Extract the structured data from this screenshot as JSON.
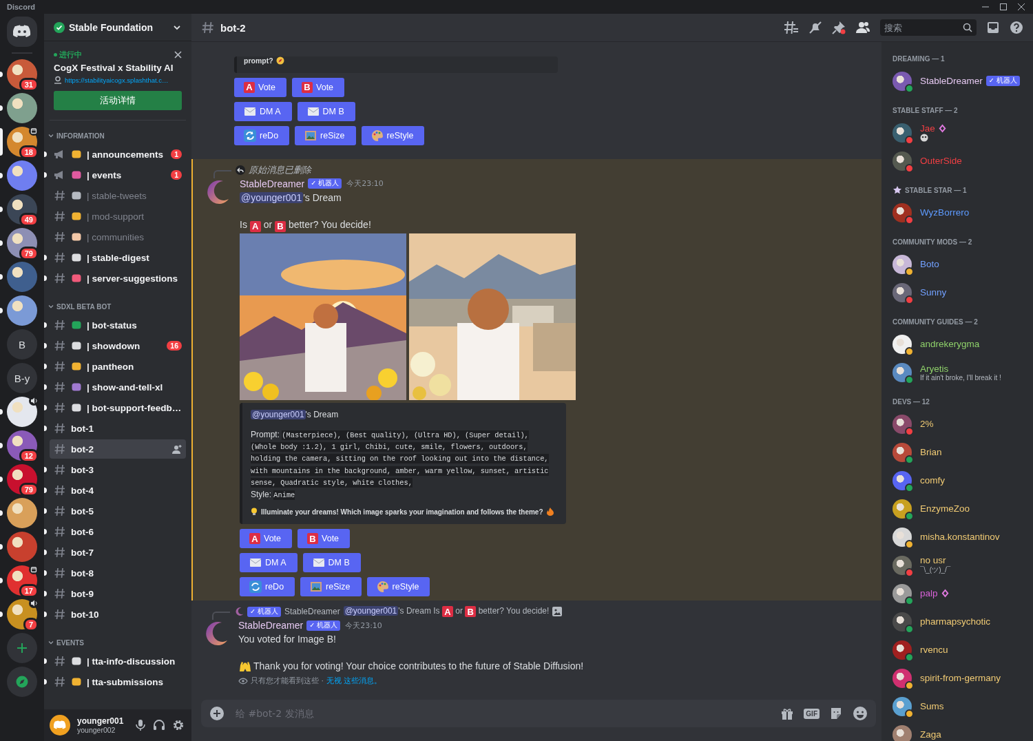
{
  "window": {
    "title": "Discord"
  },
  "servers": [
    {
      "badge": "31",
      "unread": true,
      "selected": false
    },
    {
      "unread": true,
      "selected": false
    },
    {
      "badge": "18",
      "unread": false,
      "selected": true,
      "event": true
    },
    {
      "unread": true,
      "selected": false
    },
    {
      "badge": "49",
      "unread": true,
      "selected": false
    },
    {
      "badge": "79",
      "unread": true,
      "selected": false
    },
    {
      "unread": true,
      "selected": false
    },
    {
      "unread": true,
      "selected": false
    },
    {
      "label": "B",
      "unread": false,
      "selected": false
    },
    {
      "label": "B-y",
      "unread": false,
      "selected": false
    },
    {
      "unread": true,
      "selected": false,
      "voice": true
    },
    {
      "badge": "12",
      "unread": true,
      "selected": false
    },
    {
      "badge": "79",
      "unread": true,
      "selected": false
    },
    {
      "unread": true,
      "selected": false
    },
    {
      "unread": true,
      "selected": false
    },
    {
      "badge": "17",
      "unread": true,
      "selected": false,
      "event": true
    },
    {
      "badge": "7",
      "unread": true,
      "selected": false,
      "voice": true
    }
  ],
  "server": {
    "name": "Stable Foundation"
  },
  "event": {
    "status": "进行中",
    "title": "CogX Festival x Stability AI",
    "link": "https://stabilityaicogx.splashthat.c…",
    "button": "活动详情"
  },
  "categories": [
    {
      "name": "INFORMATION",
      "expanded": true,
      "channels": [
        {
          "kind": "announce",
          "emoji": true,
          "name": "| announcements",
          "unread": true,
          "selected": false,
          "badge": "1"
        },
        {
          "kind": "announce",
          "emoji": true,
          "name": "| events",
          "unread": true,
          "selected": false,
          "badge": "1"
        },
        {
          "kind": "text",
          "emoji": true,
          "name": "| stable-tweets",
          "unread": false,
          "selected": false
        },
        {
          "kind": "text",
          "emoji": true,
          "name": "| mod-support",
          "unread": false,
          "selected": false
        },
        {
          "kind": "text",
          "emoji": true,
          "name": "| communities",
          "unread": false,
          "selected": false
        },
        {
          "kind": "text",
          "emoji": true,
          "name": "| stable-digest",
          "unread": true,
          "selected": false
        },
        {
          "kind": "text",
          "emoji": true,
          "name": "| server-suggestions",
          "unread": true,
          "selected": false
        }
      ]
    },
    {
      "name": "SDXL BETA BOT",
      "expanded": true,
      "channels": [
        {
          "kind": "text",
          "emoji": true,
          "name": "| bot-status",
          "unread": true,
          "selected": false
        },
        {
          "kind": "text",
          "emoji": true,
          "name": "| showdown",
          "unread": true,
          "selected": false,
          "badge": "16"
        },
        {
          "kind": "text",
          "emoji": true,
          "name": "| pantheon",
          "unread": true,
          "selected": false
        },
        {
          "kind": "text",
          "emoji": true,
          "name": "| show-and-tell-xl",
          "unread": true,
          "selected": false
        },
        {
          "kind": "text",
          "emoji": true,
          "name": "| bot-support-feedb…",
          "unread": true,
          "selected": false
        },
        {
          "kind": "text",
          "emoji": false,
          "name": "bot-1",
          "unread": true,
          "selected": false
        },
        {
          "kind": "text",
          "emoji": false,
          "name": "bot-2",
          "unread": false,
          "selected": true
        },
        {
          "kind": "text",
          "emoji": false,
          "name": "bot-3",
          "unread": true,
          "selected": false
        },
        {
          "kind": "text",
          "emoji": false,
          "name": "bot-4",
          "unread": true,
          "selected": false
        },
        {
          "kind": "text",
          "emoji": false,
          "name": "bot-5",
          "unread": true,
          "selected": false
        },
        {
          "kind": "text",
          "emoji": false,
          "name": "bot-6",
          "unread": true,
          "selected": false
        },
        {
          "kind": "text",
          "emoji": false,
          "name": "bot-7",
          "unread": true,
          "selected": false
        },
        {
          "kind": "text",
          "emoji": false,
          "name": "bot-8",
          "unread": true,
          "selected": false
        },
        {
          "kind": "text",
          "emoji": false,
          "name": "bot-9",
          "unread": true,
          "selected": false
        },
        {
          "kind": "text",
          "emoji": false,
          "name": "bot-10",
          "unread": true,
          "selected": false
        }
      ]
    },
    {
      "name": "EVENTS",
      "expanded": true,
      "channels": [
        {
          "kind": "text",
          "emoji": true,
          "name": "| tta-info-discussion",
          "unread": true,
          "selected": false
        },
        {
          "kind": "text",
          "emoji": true,
          "name": "| tta-submissions",
          "unread": true,
          "selected": false
        }
      ]
    }
  ],
  "user": {
    "name": "younger001",
    "tag": "younger002"
  },
  "header": {
    "channel": "bot-2",
    "search_placeholder": "搜索"
  },
  "top_embed": {
    "text": "prompt?"
  },
  "top_buttons": [
    [
      {
        "kind": "letter",
        "letter": "A",
        "label": "Vote"
      },
      {
        "kind": "letter",
        "letter": "B",
        "label": "Vote"
      }
    ],
    [
      {
        "kind": "mail",
        "label": "DM A"
      },
      {
        "kind": "mail",
        "label": "DM B"
      }
    ],
    [
      {
        "kind": "redo",
        "label": "reDo"
      },
      {
        "kind": "resize",
        "label": "reSize"
      },
      {
        "kind": "palette",
        "label": "reStyle"
      }
    ]
  ],
  "dream_message": {
    "highlighted": true,
    "reply": "原始消息已删除",
    "author": "StableDreamer",
    "bot_tag": "✓ 机器人",
    "time": "今天23:10",
    "mention": "@younger001",
    "mention_suffix": "'s Dream",
    "choice": [
      {
        "kind": "text",
        "text": "Is"
      },
      {
        "kind": "letter",
        "text": "A"
      },
      {
        "kind": "text",
        "text": "or"
      },
      {
        "kind": "letter",
        "text": "B"
      },
      {
        "kind": "text",
        "text": "better? You decide!"
      }
    ],
    "images": [
      {
        "kind": "picture"
      },
      {
        "kind": "picture"
      }
    ],
    "embed": {
      "mention": "@younger001",
      "mention_suffix": "'s Dream",
      "prompt_label": "Prompt:",
      "prompt": "(Masterpiece), (Best quality), (Ultra HD), (Super detail), (Whole body :1.2), 1 girl, Chibi, cute, smile, flowers, outdoors, holding the camera, sitting on the roof looking out into the distance, with mountains in the background, amber, warm yellow, sunset, artistic sense, Quadratic style, white clothes,",
      "style_label": "Style:",
      "style": "Anime",
      "footer": "Illuminate your dreams! Which image sparks your imagination and follows the theme?"
    },
    "buttons": [
      [
        {
          "kind": "letter",
          "letter": "A",
          "label": "Vote"
        },
        {
          "kind": "letter",
          "letter": "B",
          "label": "Vote"
        }
      ],
      [
        {
          "kind": "mail",
          "label": "DM A"
        },
        {
          "kind": "mail",
          "label": "DM B"
        }
      ],
      [
        {
          "kind": "redo",
          "label": "reDo"
        },
        {
          "kind": "resize",
          "label": "reSize"
        },
        {
          "kind": "palette",
          "label": "reStyle"
        }
      ]
    ]
  },
  "vote_message": {
    "reply": {
      "bot_tag": "✓ 机器人",
      "author": "StableDreamer",
      "mention": "@younger001",
      "segments": [
        {
          "kind": "text",
          "text": "'s Dream Is"
        },
        {
          "kind": "letter",
          "text": "A"
        },
        {
          "kind": "text",
          "text": "or"
        },
        {
          "kind": "letter",
          "text": "B"
        },
        {
          "kind": "text",
          "text": "better? You decide!"
        }
      ]
    },
    "author": "StableDreamer",
    "bot_tag": "✓ 机器人",
    "time": "今天23:10",
    "lines": [
      "You voted for Image B!",
      "Thank you for voting! Your choice contributes to the future of Stable Diffusion!"
    ],
    "note": "只有您才能看到这些 ·",
    "note_link": "无视 这些消息。"
  },
  "composer": {
    "placeholder": "给 #bot-2 发消息",
    "gif": "GIF"
  },
  "member_groups": [
    {
      "name": "DREAMING — 1",
      "kind": "plain",
      "members": [
        {
          "name": "StableDreamer",
          "color": "#e6c9f2",
          "kind": "online",
          "bot_tag": "✓ 机器人"
        }
      ]
    },
    {
      "name": "STABLE STAFF — 2",
      "kind": "plain",
      "members": [
        {
          "name": "Jae",
          "color": "#f23f43",
          "kind": "dnd",
          "boost": true,
          "activity": true
        },
        {
          "name": "OuterSide",
          "color": "#f23f43",
          "kind": "dnd"
        }
      ]
    },
    {
      "name": "STABLE STAR — 1",
      "kind": "starred",
      "members": [
        {
          "name": "WyzBorrero",
          "color": "#5e9bff",
          "kind": "dnd"
        }
      ]
    },
    {
      "name": "COMMUNITY MODS — 2",
      "kind": "plain",
      "members": [
        {
          "name": "Boto",
          "color": "#72a0ff",
          "kind": "idle"
        },
        {
          "name": "Sunny",
          "color": "#72a0ff",
          "kind": "dnd"
        }
      ]
    },
    {
      "name": "COMMUNITY GUIDES — 2",
      "kind": "plain",
      "members": [
        {
          "name": "andrekerygma",
          "color": "#8fd16a",
          "kind": "idle"
        },
        {
          "name": "Aryetis",
          "color": "#8fd16a",
          "kind": "online",
          "subtitle": "If it ain't broke, I'll break it !"
        }
      ]
    },
    {
      "name": "DEVS — 12",
      "kind": "plain",
      "members": [
        {
          "name": "2%",
          "color": "#f1cb74",
          "kind": "dnd"
        },
        {
          "name": "Brian",
          "color": "#f1cb74",
          "kind": "online"
        },
        {
          "name": "comfy",
          "color": "#f1cb74",
          "kind": "online"
        },
        {
          "name": "EnzymeZoo",
          "color": "#f1cb74",
          "kind": "online"
        },
        {
          "name": "misha.konstantinov",
          "color": "#f1cb74",
          "kind": "idle"
        },
        {
          "name": "no usr",
          "color": "#f1cb74",
          "kind": "dnd",
          "subtitle": "¯\\_(ツ)_/¯"
        },
        {
          "name": "palp",
          "color": "#d862d8",
          "kind": "online",
          "boost": true
        },
        {
          "name": "pharmapsychotic",
          "color": "#f1cb74",
          "kind": "online"
        },
        {
          "name": "rvencu",
          "color": "#f1cb74",
          "kind": "online"
        },
        {
          "name": "spirit-from-germany",
          "color": "#f1cb74",
          "kind": "idle"
        },
        {
          "name": "Sums",
          "color": "#f1cb74",
          "kind": "idle"
        },
        {
          "name": "Zaga",
          "color": "#f1cb74"
        }
      ]
    }
  ]
}
